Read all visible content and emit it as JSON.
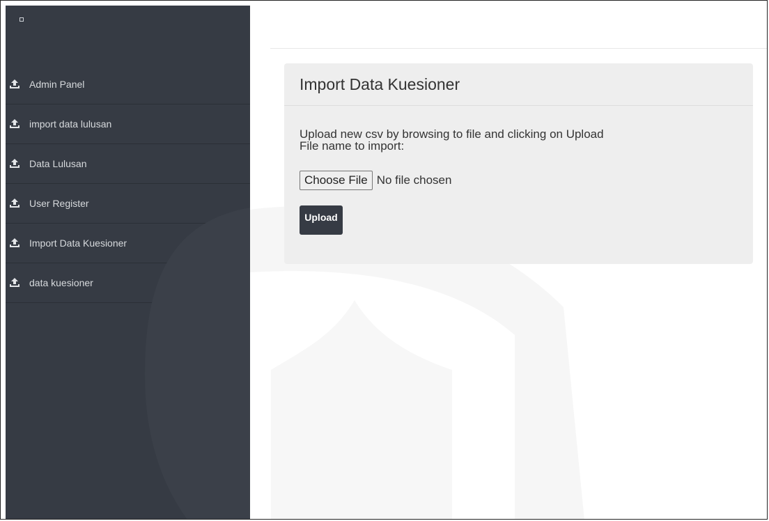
{
  "sidebar": {
    "items": [
      {
        "label": "Admin Panel",
        "icon": "upload-icon"
      },
      {
        "label": "import data lulusan",
        "icon": "upload-icon"
      },
      {
        "label": "Data Lulusan",
        "icon": "upload-icon"
      },
      {
        "label": "User Register",
        "icon": "upload-icon"
      },
      {
        "label": "Import Data Kuesioner",
        "icon": "upload-icon"
      },
      {
        "label": "data kuesioner",
        "icon": "upload-icon"
      }
    ]
  },
  "panel": {
    "title": "Import Data Kuesioner",
    "description_line1": "Upload new csv by browsing to file and clicking on Upload",
    "description_line2": "File name to import:",
    "choose_file_label": "Choose File",
    "no_file_text": "No file chosen",
    "upload_label": "Upload"
  },
  "colors": {
    "sidebar_bg": "#363b44",
    "panel_bg": "#eeeeee",
    "button_bg": "#363b44"
  }
}
